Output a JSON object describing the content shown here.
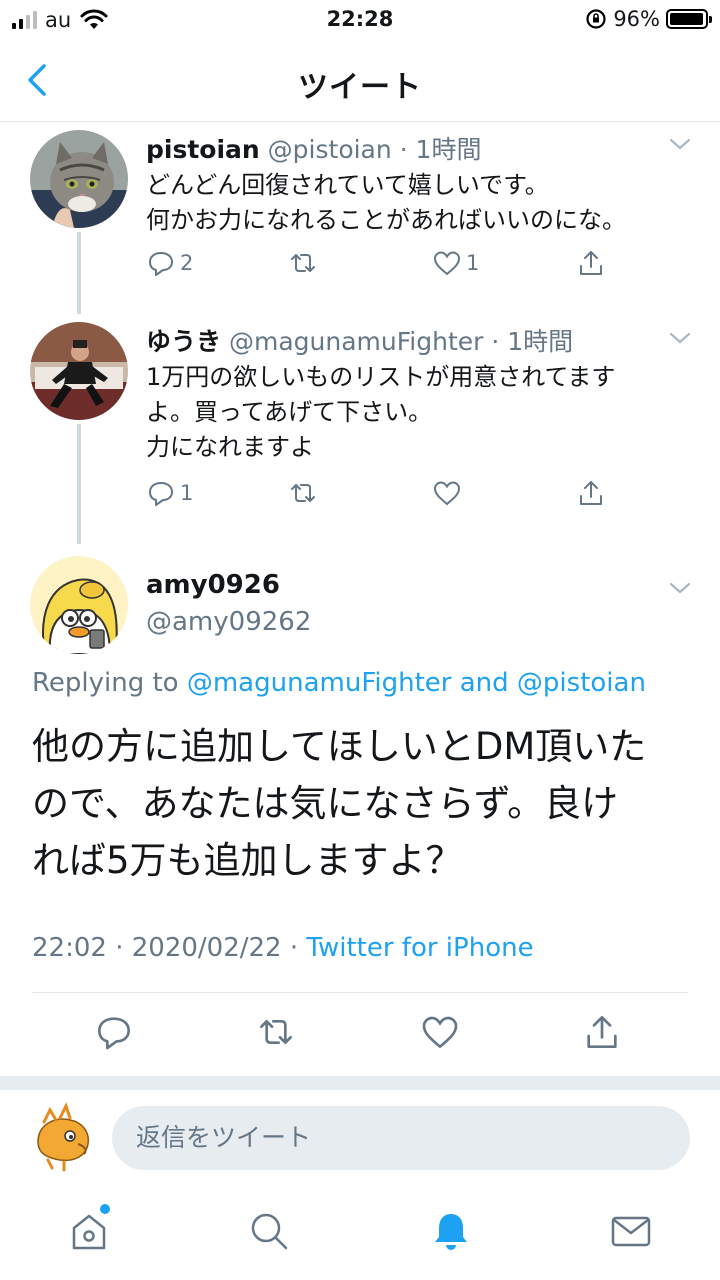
{
  "status_bar": {
    "carrier": "au",
    "time": "22:28",
    "battery_percent": "96%",
    "battery_level": 0.96
  },
  "nav": {
    "title": "ツイート",
    "back_icon": "chevron-left-icon"
  },
  "thread": [
    {
      "name": "pistoian",
      "handle": "@pistoian · 1時間",
      "lines": [
        "どんどん回復されていて嬉しいです。",
        "何かお力になれることがあればいいのにな。"
      ],
      "reply_count": "2",
      "retweet_count": "",
      "like_count": "1"
    },
    {
      "name": "ゆうき",
      "handle": "@magunamuFighter · 1時間",
      "lines": [
        "1万円の欲しいものリストが用意されてます",
        "よ。買ってあげて下さい。",
        "力になれますよ"
      ],
      "reply_count": "1",
      "retweet_count": "",
      "like_count": ""
    }
  ],
  "main_tweet": {
    "name": "amy0926",
    "handle": "@amy09262",
    "replying_prefix": "Replying to",
    "replying_user1": "@magunamuFighter",
    "replying_and": "and",
    "replying_user2": "@pistoian",
    "text_lines": [
      "他の方に追加してほしいとDM頂いた",
      "ので、あなたは気になさらず。良け",
      "れば5万も追加しますよ？"
    ],
    "time": "22:02",
    "date": "2020/02/22",
    "source": "Twitter for iPhone"
  },
  "reply_bar": {
    "placeholder": "返信をツイート"
  },
  "tabs": [
    "home-icon",
    "search-icon",
    "notifications-icon",
    "messages-icon"
  ],
  "colors": {
    "accent": "#1da1f2",
    "text": "#14171a",
    "secondary": "#657786",
    "divider": "#e1e8ed"
  }
}
